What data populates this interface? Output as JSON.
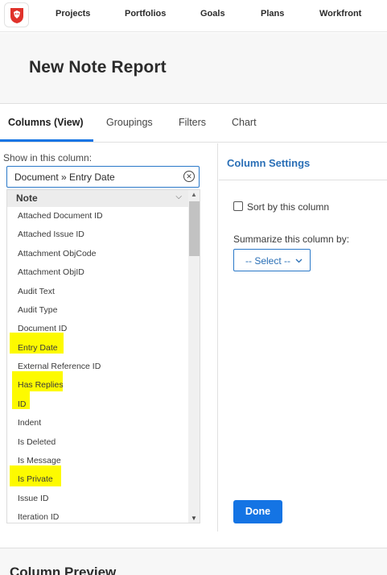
{
  "nav": {
    "logo_icon": "lion-shield-logo-icon",
    "items": [
      {
        "label": "Projects"
      },
      {
        "label": "Portfolios"
      },
      {
        "label": "Goals"
      },
      {
        "label": "Plans"
      },
      {
        "label": "Workfront"
      }
    ]
  },
  "page": {
    "title": "New Note Report"
  },
  "tabs": [
    {
      "label": "Columns (View)",
      "active": true
    },
    {
      "label": "Groupings",
      "active": false
    },
    {
      "label": "Filters",
      "active": false
    },
    {
      "label": "Chart",
      "active": false
    }
  ],
  "column_picker": {
    "show_label": "Show in this column:",
    "search_value": "Document  »  Entry Date",
    "group_label": "Note",
    "fields": [
      {
        "label": "Attached Document ID",
        "highlighted": false
      },
      {
        "label": "Attached Issue ID",
        "highlighted": false
      },
      {
        "label": "Attachment ObjCode",
        "highlighted": false
      },
      {
        "label": "Attachment ObjID",
        "highlighted": false
      },
      {
        "label": "Audit Text",
        "highlighted": false
      },
      {
        "label": "Audit Type",
        "highlighted": false
      },
      {
        "label": "Document ID",
        "highlighted": false
      },
      {
        "label": "Entry Date",
        "highlighted": true
      },
      {
        "label": "External Reference ID",
        "highlighted": false
      },
      {
        "label": "Has Replies",
        "highlighted": true
      },
      {
        "label": "ID",
        "highlighted": true
      },
      {
        "label": "Indent",
        "highlighted": false
      },
      {
        "label": "Is Deleted",
        "highlighted": false
      },
      {
        "label": "Is Message",
        "highlighted": false
      },
      {
        "label": "Is Private",
        "highlighted": true
      },
      {
        "label": "Issue ID",
        "highlighted": false
      },
      {
        "label": "Iteration ID",
        "highlighted": false
      }
    ],
    "highlight_color": "#fdfa00"
  },
  "settings": {
    "title": "Column Settings",
    "sort_label": "Sort by this column",
    "sort_checked": false,
    "summarize_label": "Summarize this column by:",
    "summarize_value": "-- Select --",
    "done_label": "Done"
  },
  "preview": {
    "title": "Column Preview"
  },
  "colors": {
    "accent": "#1474e4",
    "link": "#2a6fb6"
  }
}
